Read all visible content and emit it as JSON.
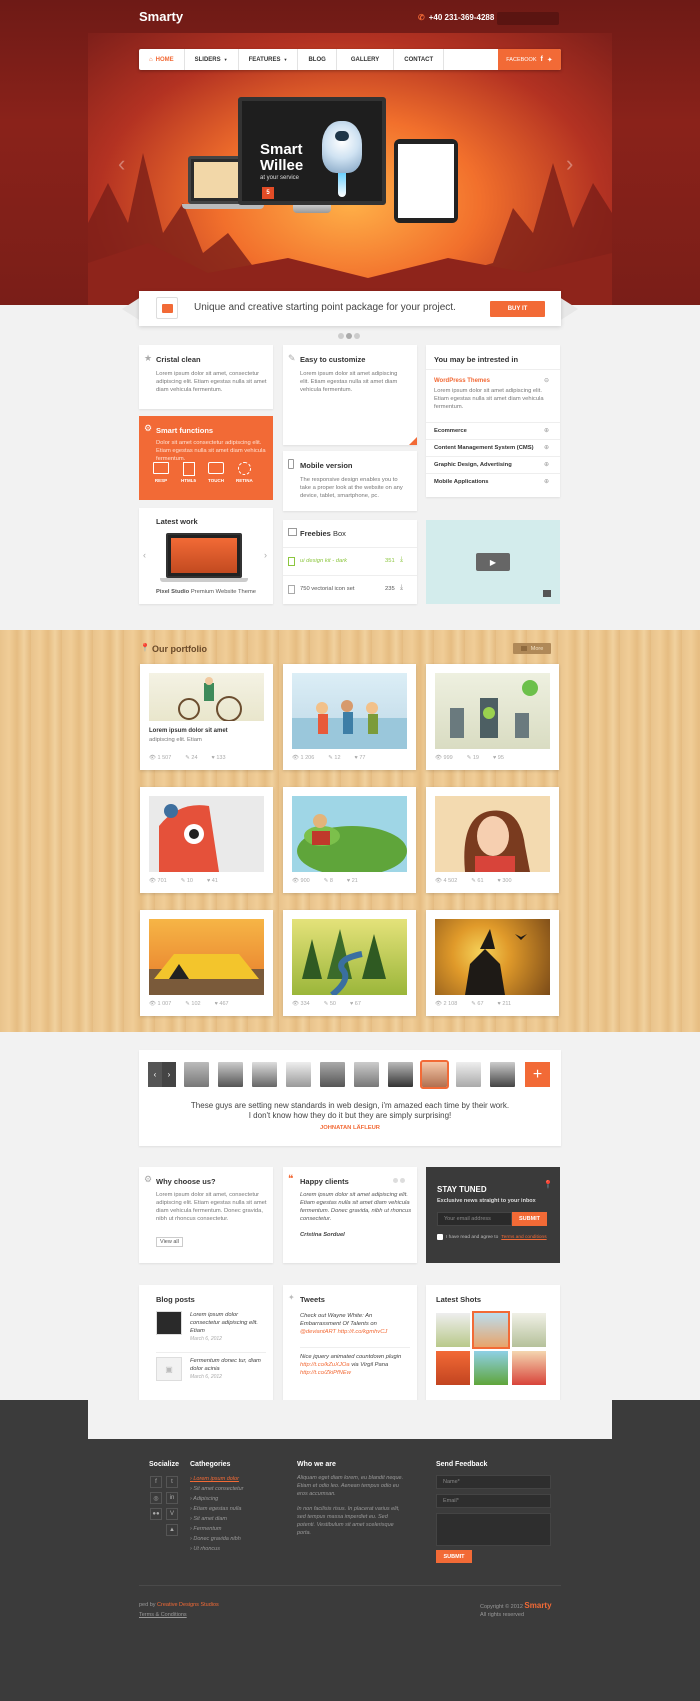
{
  "brand": {
    "logo": "Smarty",
    "phone": "+40 231-369-4288"
  },
  "nav": {
    "items": [
      "HOME",
      "SLIDERS",
      "FEATURES",
      "BLOG",
      "GALLERY",
      "CONTACT"
    ],
    "social_label": "FACEBOOK"
  },
  "hero": {
    "screen_title_1": "Smart",
    "screen_title_2": "Willee",
    "screen_subtitle": "at your service"
  },
  "ribbon": {
    "text": "Unique and creative starting point package for your project.",
    "button": "BUY IT"
  },
  "features": {
    "crystal": {
      "title": "Cristal clean",
      "text": "Lorem ipsum dolor sit amet, consectetur adipiscing elit. Etiam egestas nulla sit amet diam vehicula fermentum."
    },
    "easy": {
      "title": "Easy to customize",
      "text": "Lorem ipsum dolor sit amet adipiscing elit. Etiam egestas nulla sit amet diam vehicula fermentum."
    },
    "smart": {
      "title": "Smart functions",
      "text": "Dolor sit amet consectetur adipiscing elit. Etiam egestas nulla sit amet diam vehicula fermentum.",
      "icons": [
        "RESP",
        "HTML5",
        "TOUCH",
        "RETINA"
      ]
    },
    "mobile": {
      "title": "Mobile version",
      "text": "The responsive design enables you to take a proper look at the website on any device, tablet, smartphone, pc."
    },
    "latest": {
      "title": "Latest work",
      "caption_bold": "Pixel Studio",
      "caption": "Premium Website Theme"
    },
    "freebies": {
      "title_bold": "Freebies",
      "title": "Box",
      "items": [
        {
          "name": "ui design kit - dark",
          "count": "351"
        },
        {
          "name": "750 vectorial icon set",
          "count": "235"
        }
      ]
    },
    "interested": {
      "title": "You may be intrested in",
      "first": "WordPress Themes",
      "first_text": "Lorem ipsum dolor sit amet adipiscing elit. Etiam egestas nulla sit amet diam vehicula fermentum.",
      "items": [
        "Ecommerce",
        "Content Management System (CMS)",
        "Graphic Design, Advertising",
        "Mobile Applications"
      ]
    }
  },
  "portfolio": {
    "title": "Our portfolio",
    "more": "More",
    "first_title": "Lorem ipsum dolor sit amet",
    "first_text": "adipiscing elit. Etiam",
    "tiles": [
      {
        "views": "1 507",
        "comments": "24",
        "likes": "133"
      },
      {
        "views": "1 206",
        "comments": "12",
        "likes": "77"
      },
      {
        "views": "999",
        "comments": "19",
        "likes": "95"
      },
      {
        "views": "701",
        "comments": "10",
        "likes": "41"
      },
      {
        "views": "900",
        "comments": "8",
        "likes": "21"
      },
      {
        "views": "4 502",
        "comments": "61",
        "likes": "300"
      },
      {
        "views": "1 007",
        "comments": "102",
        "likes": "467"
      },
      {
        "views": "334",
        "comments": "50",
        "likes": "67"
      },
      {
        "views": "2 108",
        "comments": "67",
        "likes": "211"
      }
    ]
  },
  "testimonial": {
    "text1": "These guys are setting new standards in web design, i'm amazed each time by their work.",
    "text2": "I don't know how they do it but they are simply surprising!",
    "author": "JOHNATAN LÄFLEUR"
  },
  "why": {
    "title": "Why choose us?",
    "text": "Lorem ipsum dolor sit amet, consectetur adipiscing elit. Etiam egestas nulla sit amet diam vehicula fermentum. Donec gravida, nibh ut rhoncus consectetur.",
    "button": "View all"
  },
  "clients": {
    "title": "Happy clients",
    "text": "Lorem ipsum dolor sit amet adipiscing elit. Etiam egestas nulla sit amet diam vehicula fermentum. Donec gravida, nibh ut rhoncus consectetur.",
    "author": "Cristina Sorduel"
  },
  "newsletter": {
    "title": "STAY TUNED",
    "subtitle": "Exclusive news straight to your inbox",
    "placeholder": "Your email address",
    "button": "SUBMIT",
    "agree": "I have read and agree to",
    "terms": "Terms and conditions"
  },
  "blog": {
    "title": "Blog posts",
    "posts": [
      {
        "title": "Lorem ipsum dolor consectetur adipiscing elit. Etiam",
        "date": "March 6, 2012"
      },
      {
        "title": "Fermentum donec tur, diam dolor acinia",
        "date": "March 6, 2012"
      }
    ]
  },
  "tweets": {
    "title": "Tweets",
    "items": [
      {
        "text": "Check out Wayne White: An Embarrassment Of Talents on",
        "link": "@deviantART http://t.co/kgmhvCJ"
      },
      {
        "text": "Nice jquery animated countdown plugin",
        "link": "http://t.co/kZuXJOa",
        "via": "via Virgil Pana",
        "link2": "http://t.co/ZkiPfNEw"
      }
    ]
  },
  "shots": {
    "title": "Latest Shots"
  },
  "footer": {
    "socialize": "Socialize",
    "categories_title": "Cathegories",
    "categories": [
      "Lorem ipsum dolor",
      "Sit amet consectetur",
      "Adipiscing",
      "Etiam egestas nulla",
      "Sit amet diam",
      "Fermentum",
      "Donec gravida nibh",
      "Ut rhoncus"
    ],
    "who_title": "Who we are",
    "who_text1": "Aliquam eget diam lorem, eu blandit neque. Etiam et odio leo. Aenean tempus odio eu eros accumsan.",
    "who_text2": "In non facilisis risus. In placerat varius elit, sed tempus massa imperdiet eu. Sed potenti. Vestibulum sit amet scelerisque porta.",
    "feedback_title": "Send Feedback",
    "name_ph": "Name*",
    "email_ph": "Email*",
    "submit": "SUBMIT",
    "designed_prefix": "ped by",
    "designed_by": "Creative Designs Studios",
    "terms": "Terms & Conditions",
    "copyright": "Copyright © 2012",
    "copy_brand": "Smarty",
    "rights": "All rights reserved"
  },
  "colors": {
    "accent": "#f26a36",
    "dark": "#3b3b3b"
  }
}
